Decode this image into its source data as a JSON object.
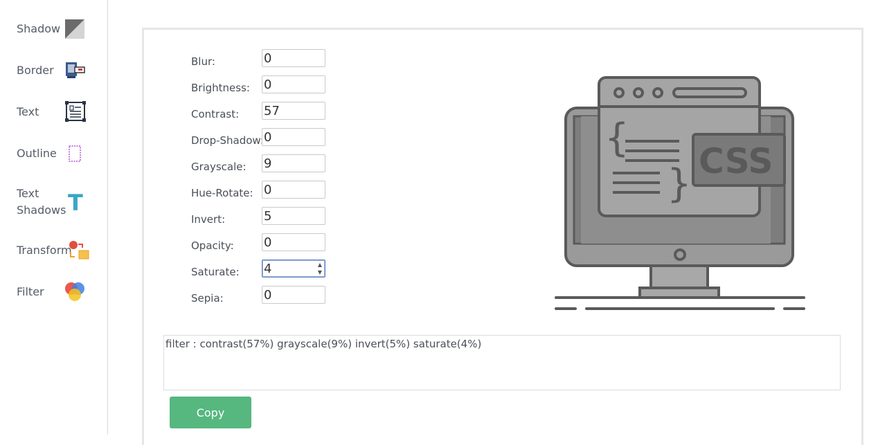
{
  "sidebar": {
    "items": [
      {
        "label": "Shadow",
        "icon": "shadow-icon"
      },
      {
        "label": "Border",
        "icon": "border-icon"
      },
      {
        "label": "Text",
        "icon": "text-icon"
      },
      {
        "label": "Outline",
        "icon": "outline-icon"
      },
      {
        "label": "Text Shadows",
        "icon": "text-shadows-icon"
      },
      {
        "label": "Transform",
        "icon": "transform-icon"
      },
      {
        "label": "Filter",
        "icon": "filter-icon"
      }
    ]
  },
  "form": {
    "fields": [
      {
        "label": "Blur:",
        "value": "0"
      },
      {
        "label": "Brightness:",
        "value": "0"
      },
      {
        "label": "Contrast:",
        "value": "57"
      },
      {
        "label": "Drop-Shadow:",
        "value": "0"
      },
      {
        "label": "Grayscale:",
        "value": "9"
      },
      {
        "label": "Hue-Rotate:",
        "value": "0"
      },
      {
        "label": "Invert:",
        "value": "5"
      },
      {
        "label": "Opacity:",
        "value": "0"
      },
      {
        "label": "Saturate:",
        "value": "4"
      },
      {
        "label": "Sepia:",
        "value": "0"
      }
    ]
  },
  "output": {
    "text": "filter : contrast(57%) grayscale(9%) invert(5%) saturate(4%)"
  },
  "copy_button": {
    "label": "Copy"
  },
  "illustration": {
    "badge_text": "CSS"
  },
  "colors": {
    "accent": "#56b77f",
    "focus": "#5b7fbf",
    "illustration_gray": "#9a9a9a"
  }
}
